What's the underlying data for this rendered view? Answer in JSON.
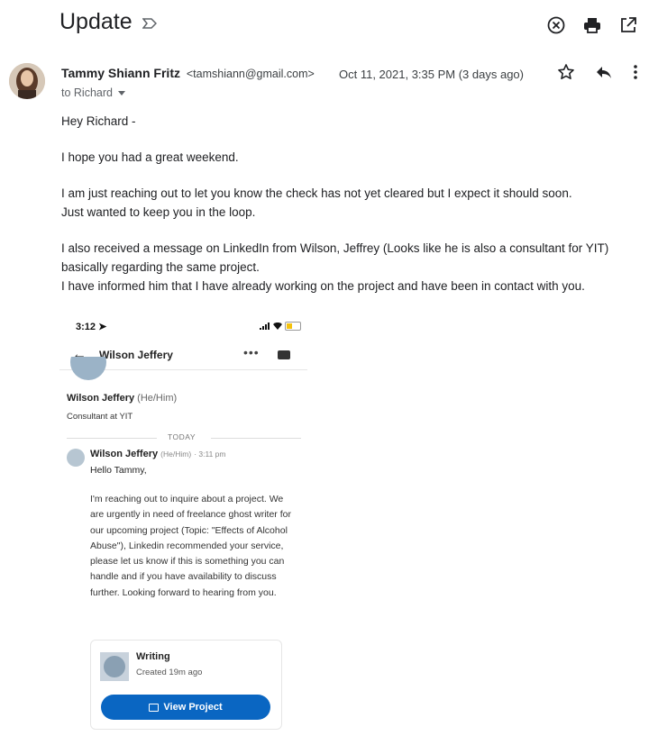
{
  "email": {
    "subject": "Update",
    "sender_name": "Tammy Shiann Fritz",
    "sender_email": "<tamshiann@gmail.com>",
    "date": "Oct 11, 2021, 3:35 PM (3 days ago)",
    "to": "to Richard",
    "body": [
      "Hey Richard -",
      "I hope you had a great weekend.",
      "I am just reaching out to let you know the check has not yet cleared but I expect it should soon.",
      "Just wanted to keep you in the loop.",
      "I also received a message on LinkedIn from Wilson, Jeffrey (Looks like he is also a consultant for YIT)",
      "basically regarding the same project.",
      "I have informed him that I have already working on the project and have been in contact with you."
    ]
  },
  "phone": {
    "time": "3:12",
    "contact_name": "Wilson Jeffery",
    "profile_name": "Wilson Jeffery",
    "profile_pronouns": "(He/Him)",
    "profile_title": "Consultant at YIT",
    "divider_label": "TODAY",
    "msg_sender": "Wilson Jeffery",
    "msg_pronouns": "(He/Him)",
    "msg_time": "· 3:11 pm",
    "greeting": "Hello Tammy,",
    "message": "I'm reaching out to inquire about a project. We are urgently in need of freelance ghost writer for our upcoming project (Topic: \"Effects of Alcohol Abuse\"), Linkedin recommended your service, please let us know if this is something you can handle and if you have availability to discuss further. Looking forward to hearing from you.",
    "card_title": "Writing",
    "card_subtitle": "Created 19m ago",
    "card_button": "View Project",
    "accent_color": "#0a66c2"
  }
}
